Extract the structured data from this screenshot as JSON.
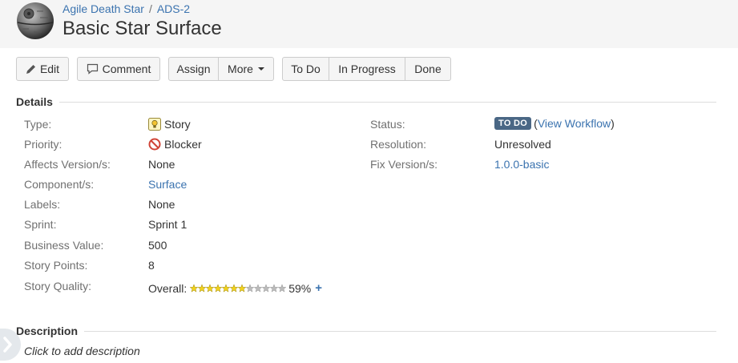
{
  "breadcrumb": {
    "project": "Agile Death Star",
    "separator": "/",
    "issue_key": "ADS-2"
  },
  "issue": {
    "title": "Basic Star Surface"
  },
  "toolbar": {
    "edit": "Edit",
    "comment": "Comment",
    "assign": "Assign",
    "more": "More",
    "todo": "To Do",
    "in_progress": "In Progress",
    "done": "Done"
  },
  "details": {
    "heading": "Details",
    "left": [
      {
        "label": "Type:",
        "value": "Story",
        "icon": "story-icon"
      },
      {
        "label": "Priority:",
        "value": "Blocker",
        "icon": "blocker-icon"
      },
      {
        "label": "Affects Version/s:",
        "value": "None"
      },
      {
        "label": "Component/s:",
        "value": "Surface"
      },
      {
        "label": "Labels:",
        "value": "None"
      },
      {
        "label": "Sprint:",
        "value": "Sprint 1"
      },
      {
        "label": "Business Value:",
        "value": "500"
      },
      {
        "label": "Story Points:",
        "value": "8"
      },
      {
        "label": "Story Quality:",
        "overall_label": "Overall:",
        "percent": "59%",
        "plus": "+",
        "star_count": 12,
        "stars_filled": 7
      }
    ],
    "right": [
      {
        "label": "Status:",
        "lozenge": "TO DO",
        "open_paren": "(",
        "link": "View Workflow",
        "close_paren": ")"
      },
      {
        "label": "Resolution:",
        "value": "Unresolved"
      },
      {
        "label": "Fix Version/s:",
        "value": "1.0.0-basic"
      }
    ]
  },
  "description": {
    "heading": "Description",
    "placeholder": "Click to add description"
  },
  "colors": {
    "link": "#3b73af",
    "lozenge": "#4a6785",
    "star_filled": "#f2d21c",
    "star_empty": "#bbbbbb",
    "blocker": "#d04437"
  }
}
